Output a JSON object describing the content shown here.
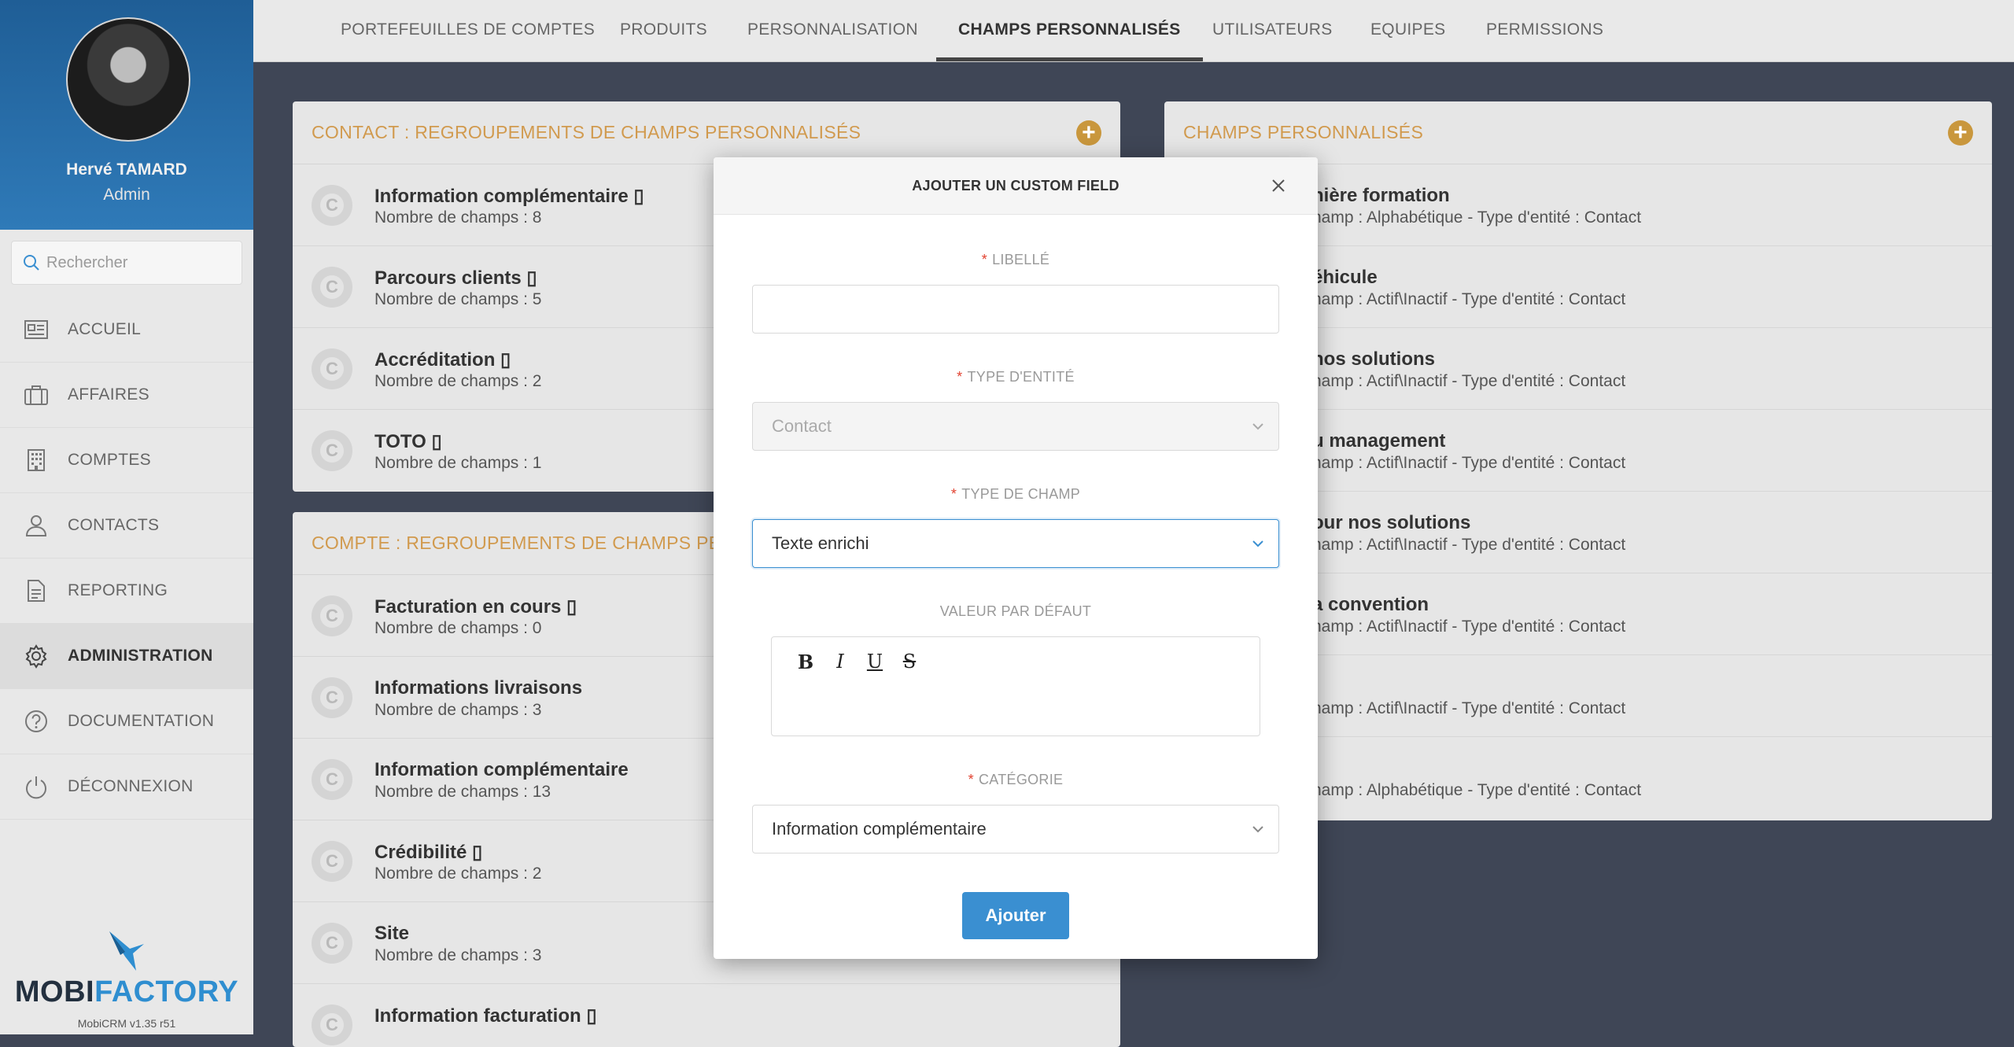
{
  "user": {
    "name": "Hervé TAMARD",
    "role": "Admin"
  },
  "search": {
    "placeholder": "Rechercher"
  },
  "sidebar": {
    "items": [
      {
        "label": "ACCUEIL",
        "icon": "newspaper-icon"
      },
      {
        "label": "AFFAIRES",
        "icon": "briefcase-icon"
      },
      {
        "label": "COMPTES",
        "icon": "building-icon"
      },
      {
        "label": "CONTACTS",
        "icon": "user-icon"
      },
      {
        "label": "REPORTING",
        "icon": "document-icon"
      },
      {
        "label": "ADMINISTRATION",
        "icon": "gear-icon",
        "active": true
      },
      {
        "label": "DOCUMENTATION",
        "icon": "help-circle-icon"
      },
      {
        "label": "DÉCONNEXION",
        "icon": "power-icon"
      }
    ]
  },
  "logo": {
    "part1": "MOBI",
    "part2": "FACTORY",
    "version": "MobiCRM v1.35 r51"
  },
  "tabs": [
    {
      "label": "PORTEFEUILLES DE COMPTES"
    },
    {
      "label": "PRODUITS"
    },
    {
      "label": "PERSONNALISATION"
    },
    {
      "label": "CHAMPS PERSONNALISÉS",
      "active": true
    },
    {
      "label": "UTILISATEURS"
    },
    {
      "label": "EQUIPES"
    },
    {
      "label": "PERMISSIONS"
    }
  ],
  "contact_panel": {
    "title": "CONTACT : REGROUPEMENTS DE CHAMPS PERSONNALISÉS",
    "rows": [
      {
        "title": "Information complémentaire",
        "sub": "Nombre de champs : 8",
        "mobile": true
      },
      {
        "title": "Parcours clients",
        "sub": "Nombre de champs : 5",
        "mobile": true
      },
      {
        "title": "Accréditation",
        "sub": "Nombre de champs : 2",
        "mobile": true
      },
      {
        "title": "TOTO",
        "sub": "Nombre de champs : 1",
        "mobile": true
      }
    ]
  },
  "compte_panel": {
    "title": "COMPTE : REGROUPEMENTS DE CHAMPS PERSONNALISÉS",
    "rows": [
      {
        "title": "Facturation en cours",
        "sub": "Nombre de champs : 0",
        "mobile": true
      },
      {
        "title": "Informations livraisons",
        "sub": "Nombre de champs : 3",
        "mobile": false
      },
      {
        "title": "Information complémentaire",
        "sub": "Nombre de champs : 13",
        "mobile": false
      },
      {
        "title": "Crédibilité",
        "sub": "Nombre de champs : 2",
        "mobile": true
      },
      {
        "title": "Site",
        "sub": "Nombre de champs : 3",
        "mobile": false
      },
      {
        "title": "Information facturation",
        "sub": "",
        "mobile": true
      }
    ]
  },
  "fields_panel": {
    "title": "CHAMPS PERSONNALISÉS",
    "rows": [
      {
        "title": "nière formation",
        "sub": "hamp : Alphabétique - Type d'entité : Contact"
      },
      {
        "title": "éhicule",
        "sub": "hamp : Actif\\Inactif - Type d'entité : Contact"
      },
      {
        "title": "nos solutions",
        "sub": "hamp : Actif\\Inactif - Type d'entité : Contact"
      },
      {
        "title": "u management",
        "sub": "hamp : Actif\\Inactif - Type d'entité : Contact"
      },
      {
        "title": "our nos solutions",
        "sub": "hamp : Actif\\Inactif - Type d'entité : Contact"
      },
      {
        "title": "a convention",
        "sub": "hamp : Actif\\Inactif - Type d'entité : Contact"
      },
      {
        "title": "",
        "sub": "hamp : Actif\\Inactif - Type d'entité : Contact"
      },
      {
        "title": "",
        "sub": "hamp : Alphabétique - Type d'entité : Contact"
      }
    ]
  },
  "modal": {
    "title": "AJOUTER UN CUSTOM FIELD",
    "libelle_label": "LIBELLÉ",
    "libelle_value": "",
    "entity_label": "TYPE D'ENTITÉ",
    "entity_value": "Contact",
    "field_type_label": "TYPE DE CHAMP",
    "field_type_value": "Texte enrichi",
    "default_label": "VALEUR PAR DÉFAUT",
    "editor_tools": [
      "B",
      "I",
      "U",
      "S"
    ],
    "category_label": "CATÉGORIE",
    "category_value": "Information complémentaire",
    "submit_label": "Ajouter"
  },
  "colors": {
    "accent": "#3a8fd1",
    "panel_title": "#d19a4e",
    "sidebar_header": "#2a6fac",
    "background": "#3f4656"
  }
}
